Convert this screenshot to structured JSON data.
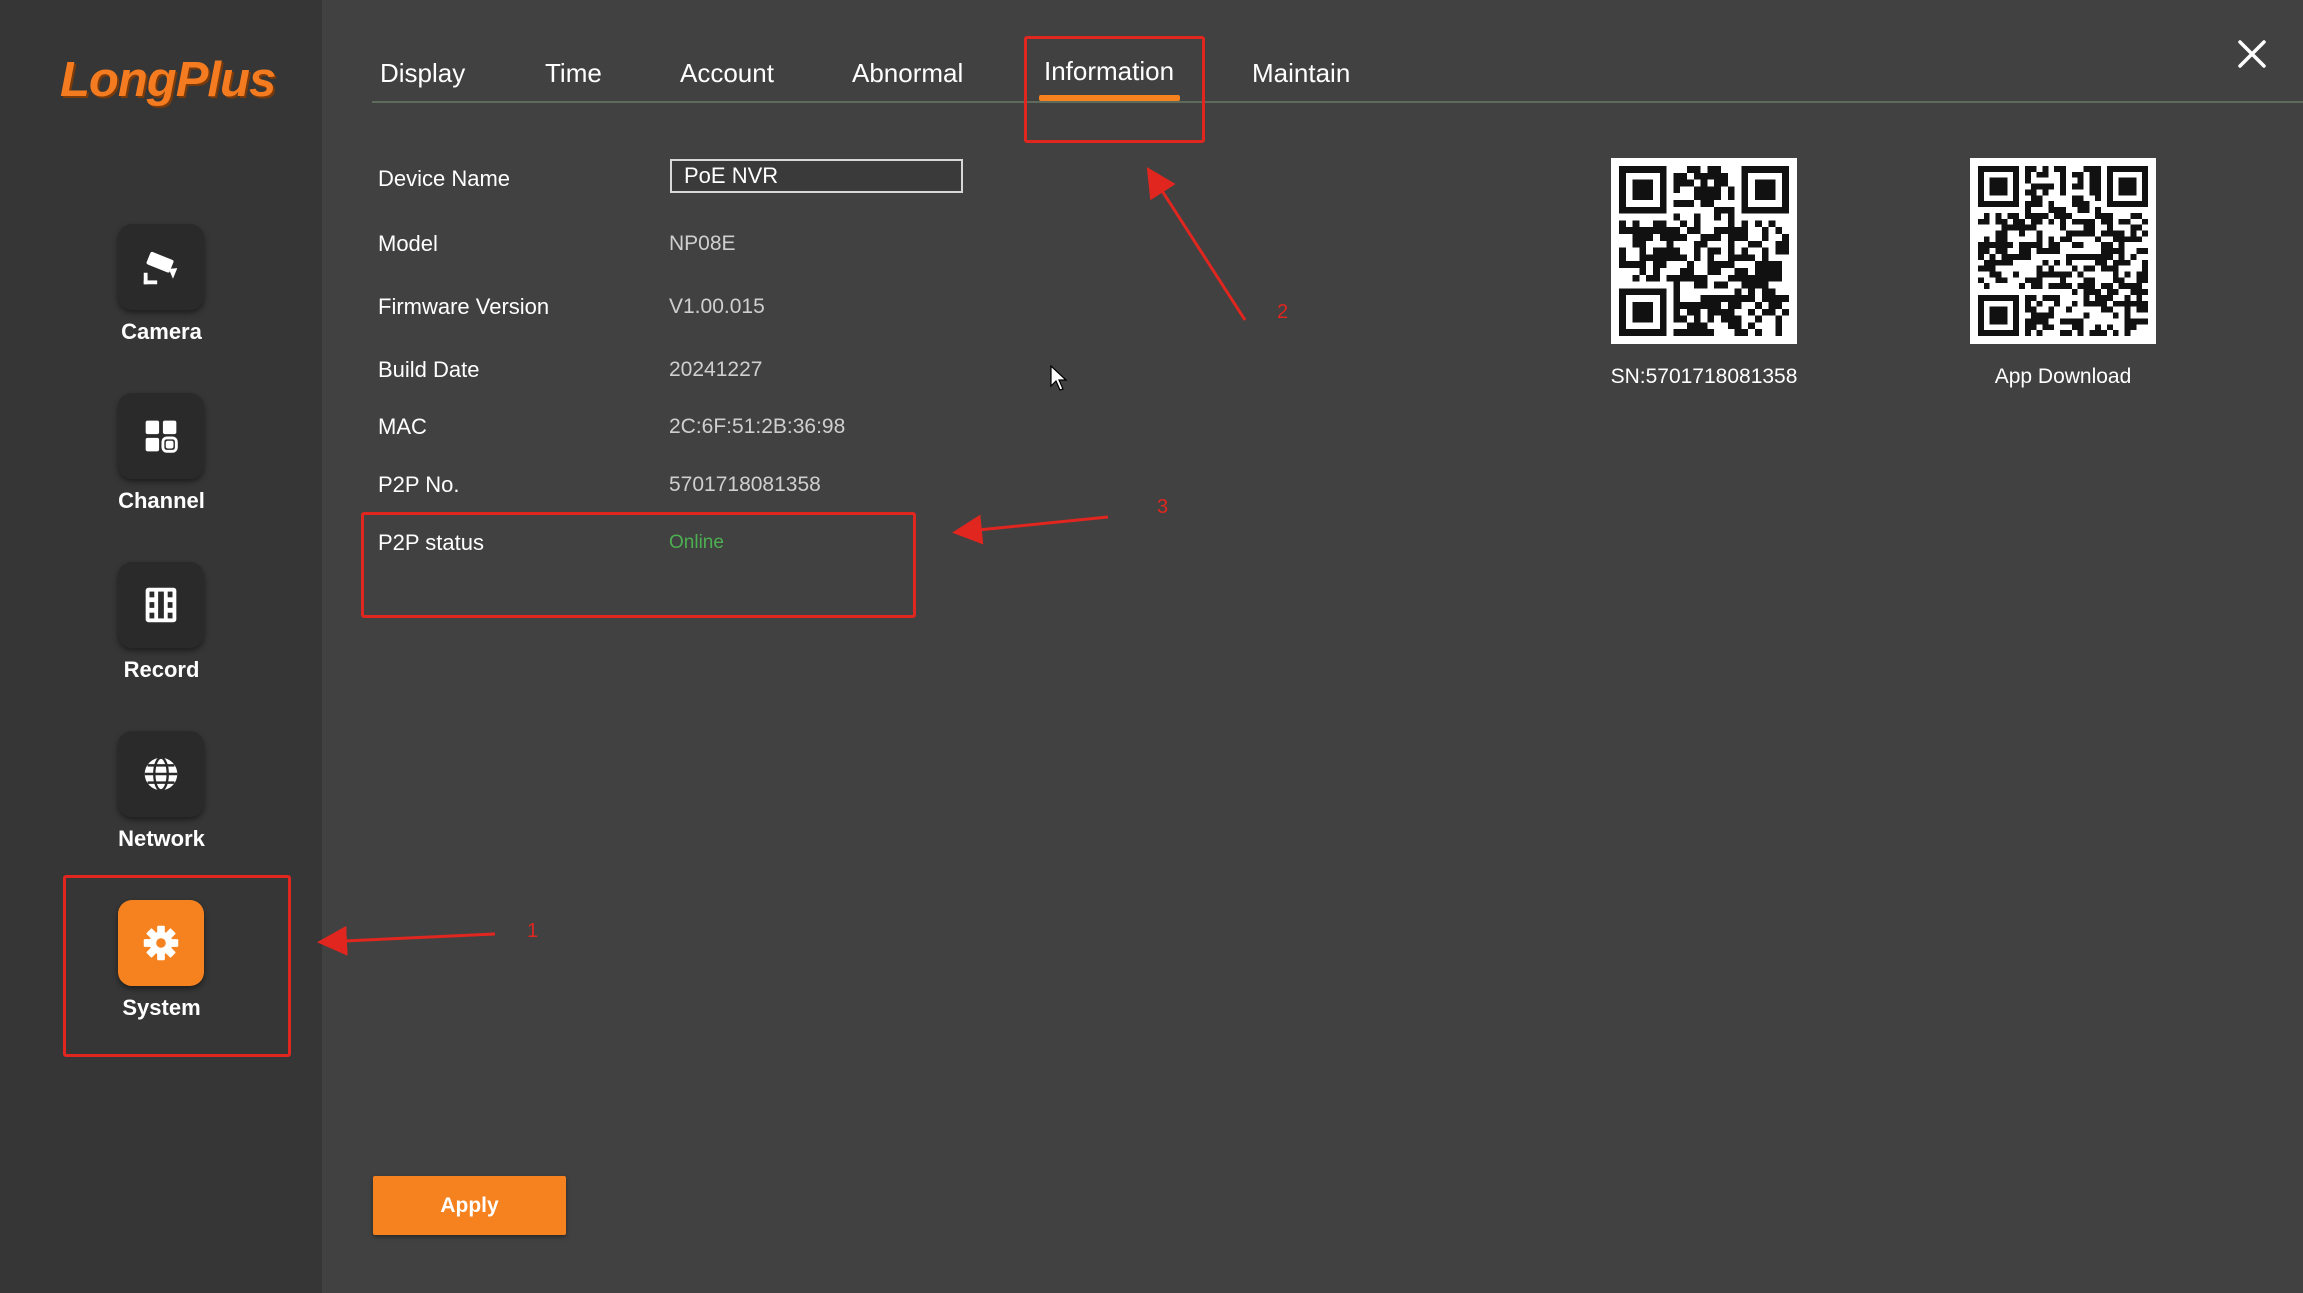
{
  "brand": {
    "logo_text": "LongPlus",
    "accent_color": "#f6821f",
    "annotation_color": "#e0261f"
  },
  "sidebar": {
    "items": [
      {
        "label": "Camera",
        "icon": "camera-icon",
        "active": false
      },
      {
        "label": "Channel",
        "icon": "grid-icon",
        "active": false
      },
      {
        "label": "Record",
        "icon": "film-icon",
        "active": false
      },
      {
        "label": "Network",
        "icon": "globe-icon",
        "active": false
      },
      {
        "label": "System",
        "icon": "gear-icon",
        "active": true
      }
    ]
  },
  "tabs": [
    {
      "label": "Display",
      "active": false
    },
    {
      "label": "Time",
      "active": false
    },
    {
      "label": "Account",
      "active": false
    },
    {
      "label": "Abnormal",
      "active": false
    },
    {
      "label": "Information",
      "active": true
    },
    {
      "label": "Maintain",
      "active": false
    }
  ],
  "info": {
    "device_name_label": "Device Name",
    "device_name_value": "PoE NVR",
    "model_label": "Model",
    "model_value": "NP08E",
    "firmware_label": "Firmware Version",
    "firmware_value": "V1.00.015",
    "build_date_label": "Build Date",
    "build_date_value": "20241227",
    "mac_label": "MAC",
    "mac_value": "2C:6F:51:2B:36:98",
    "p2p_no_label": "P2P No.",
    "p2p_no_value": "5701718081358",
    "p2p_status_label": "P2P status",
    "p2p_status_value": "Online",
    "status_color": "#4caf50"
  },
  "qr_codes": {
    "sn_caption": "SN:5701718081358",
    "app_caption": "App Download"
  },
  "actions": {
    "apply_label": "Apply"
  },
  "annotations": {
    "one": "1",
    "two": "2",
    "three": "3"
  }
}
